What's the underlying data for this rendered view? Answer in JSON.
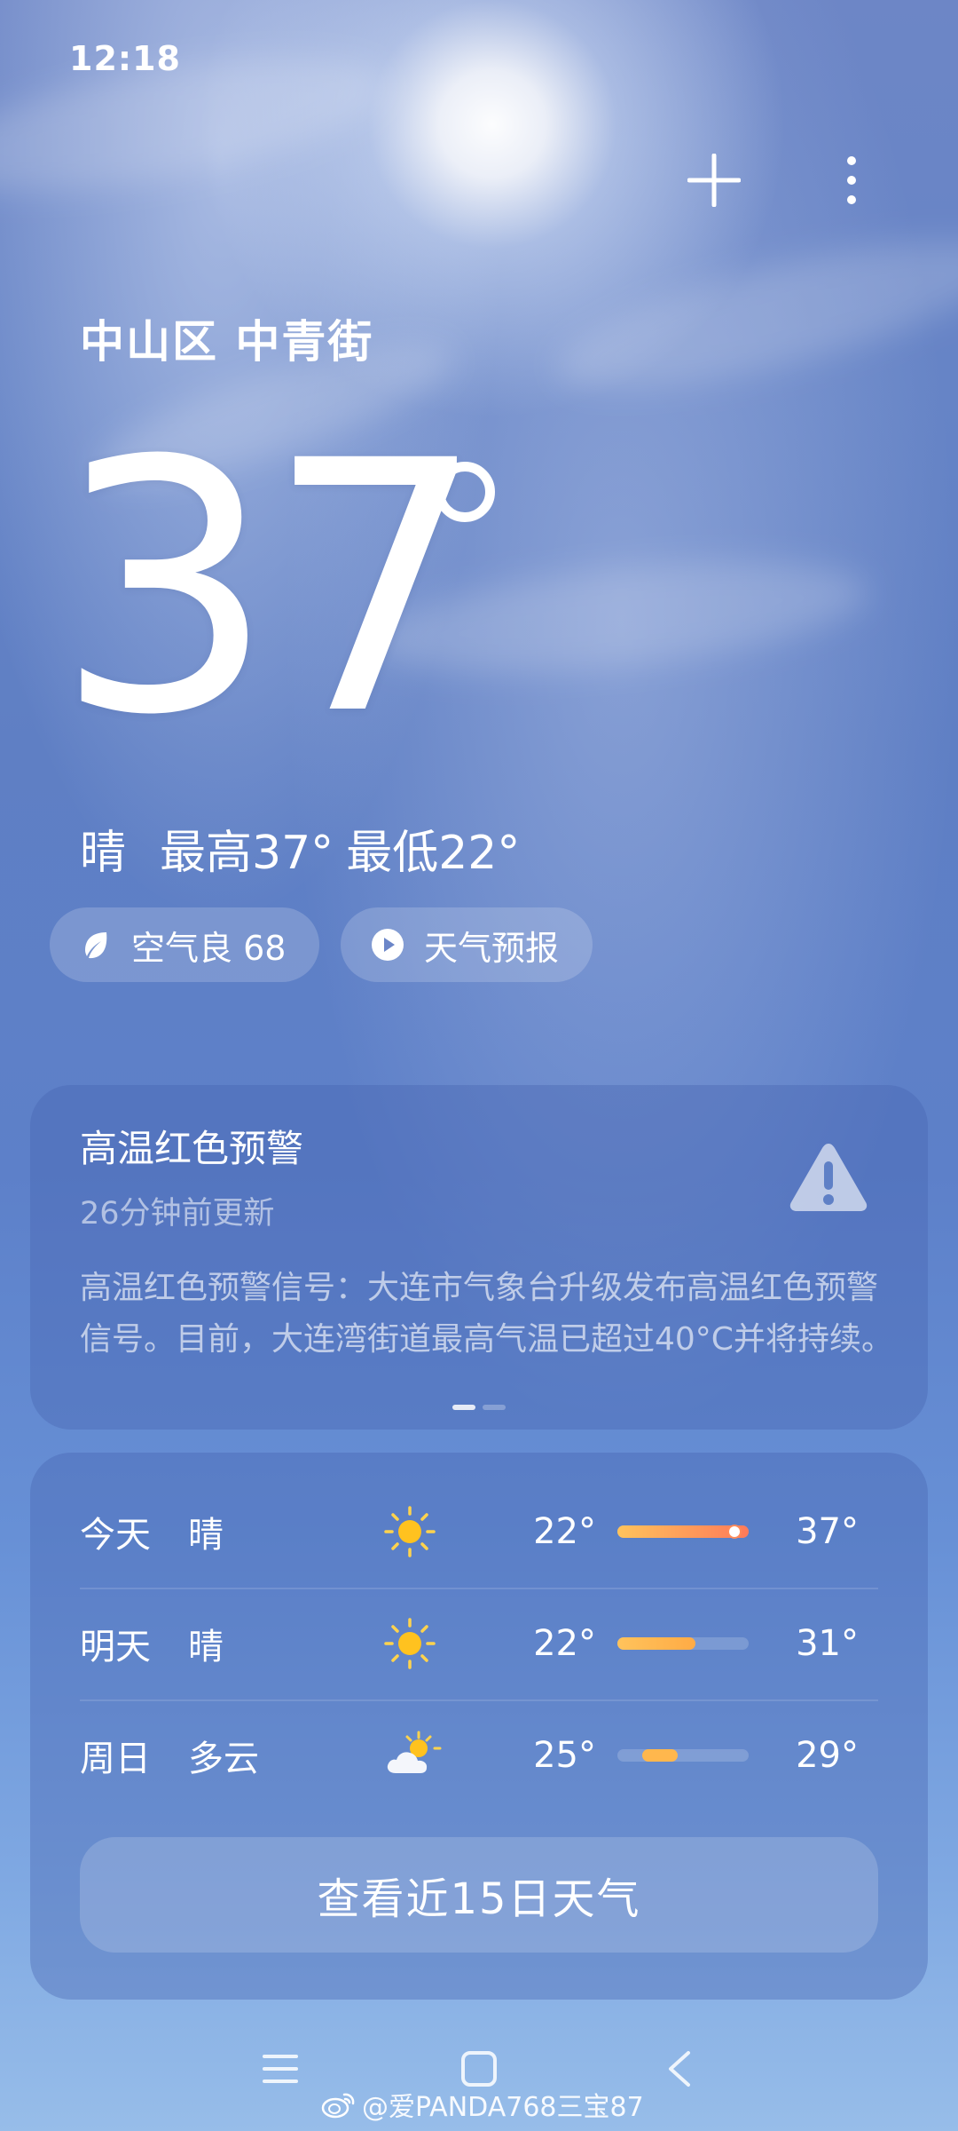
{
  "status_bar": {
    "time": "12:18"
  },
  "header": {
    "add_icon": "plus-icon",
    "menu_icon": "more-vertical-icon"
  },
  "location": "中山区 中青街",
  "current": {
    "temperature": "37",
    "condition": "晴",
    "high": "最高37°",
    "low": "最低22°"
  },
  "chips": {
    "air_quality": "空气良 68",
    "forecast_video": "天气预报"
  },
  "alert": {
    "title": "高温红色预警",
    "updated": "26分钟前更新",
    "body": "高温红色预警信号：大连市气象台升级发布高温红色预警信号。目前，大连湾街道最高气温已超过40°C并将持续。",
    "icon": "warning-icon",
    "page": 1,
    "pages": 2
  },
  "forecast": [
    {
      "day": "今天",
      "condition": "晴",
      "icon": "sunny-icon",
      "low": "22°",
      "high": "37°"
    },
    {
      "day": "明天",
      "condition": "晴",
      "icon": "sunny-icon",
      "low": "22°",
      "high": "31°"
    },
    {
      "day": "周日",
      "condition": "多云",
      "icon": "partly-cloudy-icon",
      "low": "25°",
      "high": "29°"
    }
  ],
  "forecast_button": "查看近15日天气",
  "watermark": "@爱PANDA768三宝87",
  "colors": {
    "sky_top": "#6d86c6",
    "sky_bottom": "#97bde9",
    "bar_warm": "#ffb74d",
    "bar_hot": "#ff7a59"
  }
}
